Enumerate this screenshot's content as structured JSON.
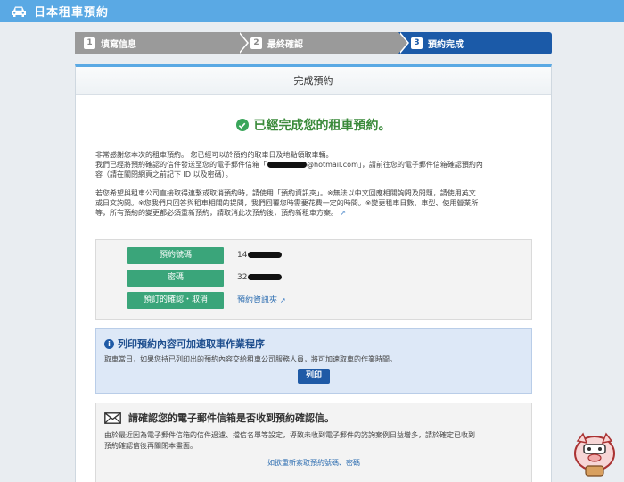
{
  "header": {
    "title": "日本租車預約",
    "icon": "car-icon"
  },
  "steps": [
    {
      "num": "1",
      "label": "填寫信息"
    },
    {
      "num": "2",
      "label": "最終確認"
    },
    {
      "num": "3",
      "label": "預約完成"
    }
  ],
  "panel": {
    "title": "完成預約",
    "done_message": "已經完成您的租車預約。",
    "para1_line1": "非常感謝您本次的租車預約。 您已經可以於預約的取車日及地點領取車輛。",
    "para1_line2a": "我們已經將預約確認的信件發送至您的電子郵件信箱「",
    "para1_email_suffix": "@hotmail.com」",
    "para1_line2b": "，請前往您的電子郵件信箱確認預約內",
    "para1_line3": "容（請在關閉網頁之前記下 ID 以及密碼）。",
    "para2_line1": "若您希望與租車公司直接取得連繫或取消預約時，請使用「預約資訊夾」。※無法以中文回應相關詢問及問題，請使用英文",
    "para2_line2": "或日文詢問。※您我們只回答與租車相關的提問，我們回覆您時需要花費一定的時間。※變更租車日數、車型、使用營業所",
    "para2_line3": "等，所有預約的變更都必須重新預約，請取消此次預約後，預約新租車方案。"
  },
  "booking": {
    "number_label": "預約號碼",
    "number_value_prefix": "14",
    "password_label": "密碼",
    "password_value_prefix": "32",
    "manage_label": "預訂的確認・取消",
    "manage_link": "預約資訊夾"
  },
  "print_section": {
    "title": "列印預約內容可加速取車作業程序",
    "text": "取車當日，如果您持已列印出的預約內容交給租車公司服務人員，將可加速取車的作業時間。",
    "button": "列印"
  },
  "mail_section": {
    "title": "請確認您的電子郵件信箱是否收到預約確認信。",
    "text_line1": "由於最近因為電子郵件信箱的信件過濾、擋信名單等設定，導致未收到電子郵件的諮詢案例日益增多，請於確定已收到",
    "text_line2": "預約確認信後再關閉本畫面。",
    "resend_link": "如欲重新索取預約號碼、密碼"
  },
  "colors": {
    "accent": "#5aa9e4",
    "step_active": "#1b5aa8",
    "step_inactive": "#9a9a9a",
    "success": "#3aa55a",
    "green_button": "#3aa57a"
  }
}
